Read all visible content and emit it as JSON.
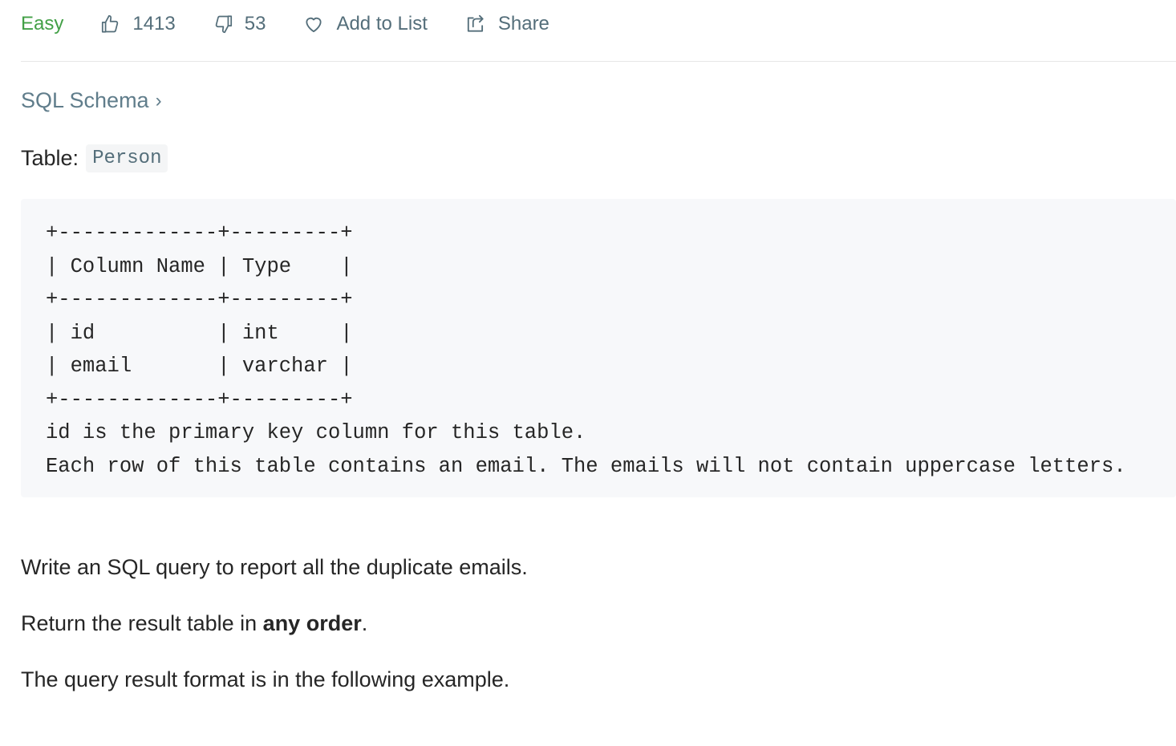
{
  "toolbar": {
    "difficulty": "Easy",
    "likes": "1413",
    "dislikes": "53",
    "add_to_list": "Add to List",
    "share": "Share"
  },
  "schema_link": {
    "label": "SQL Schema",
    "chevron": "›"
  },
  "table_heading": {
    "prefix": "Table:",
    "name": "Person"
  },
  "schema_block": {
    "lines": [
      "+-------------+---------+",
      "| Column Name | Type    |",
      "+-------------+---------+",
      "| id          | int     |",
      "| email       | varchar |",
      "+-------------+---------+",
      "id is the primary key column for this table.",
      "Each row of this table contains an email. The emails will not contain uppercase letters."
    ]
  },
  "description": {
    "p1": "Write an SQL query to report all the duplicate emails.",
    "p2_before": "Return the result table in ",
    "p2_bold": "any order",
    "p2_after": ".",
    "p3": "The query result format is in the following example."
  },
  "colors": {
    "difficulty_easy": "#43a047",
    "muted": "#546e7a",
    "text": "#262626",
    "code_bg": "#f7f8fa"
  },
  "icons": [
    "thumbs-up-icon",
    "thumbs-down-icon",
    "heart-icon",
    "share-icon"
  ]
}
